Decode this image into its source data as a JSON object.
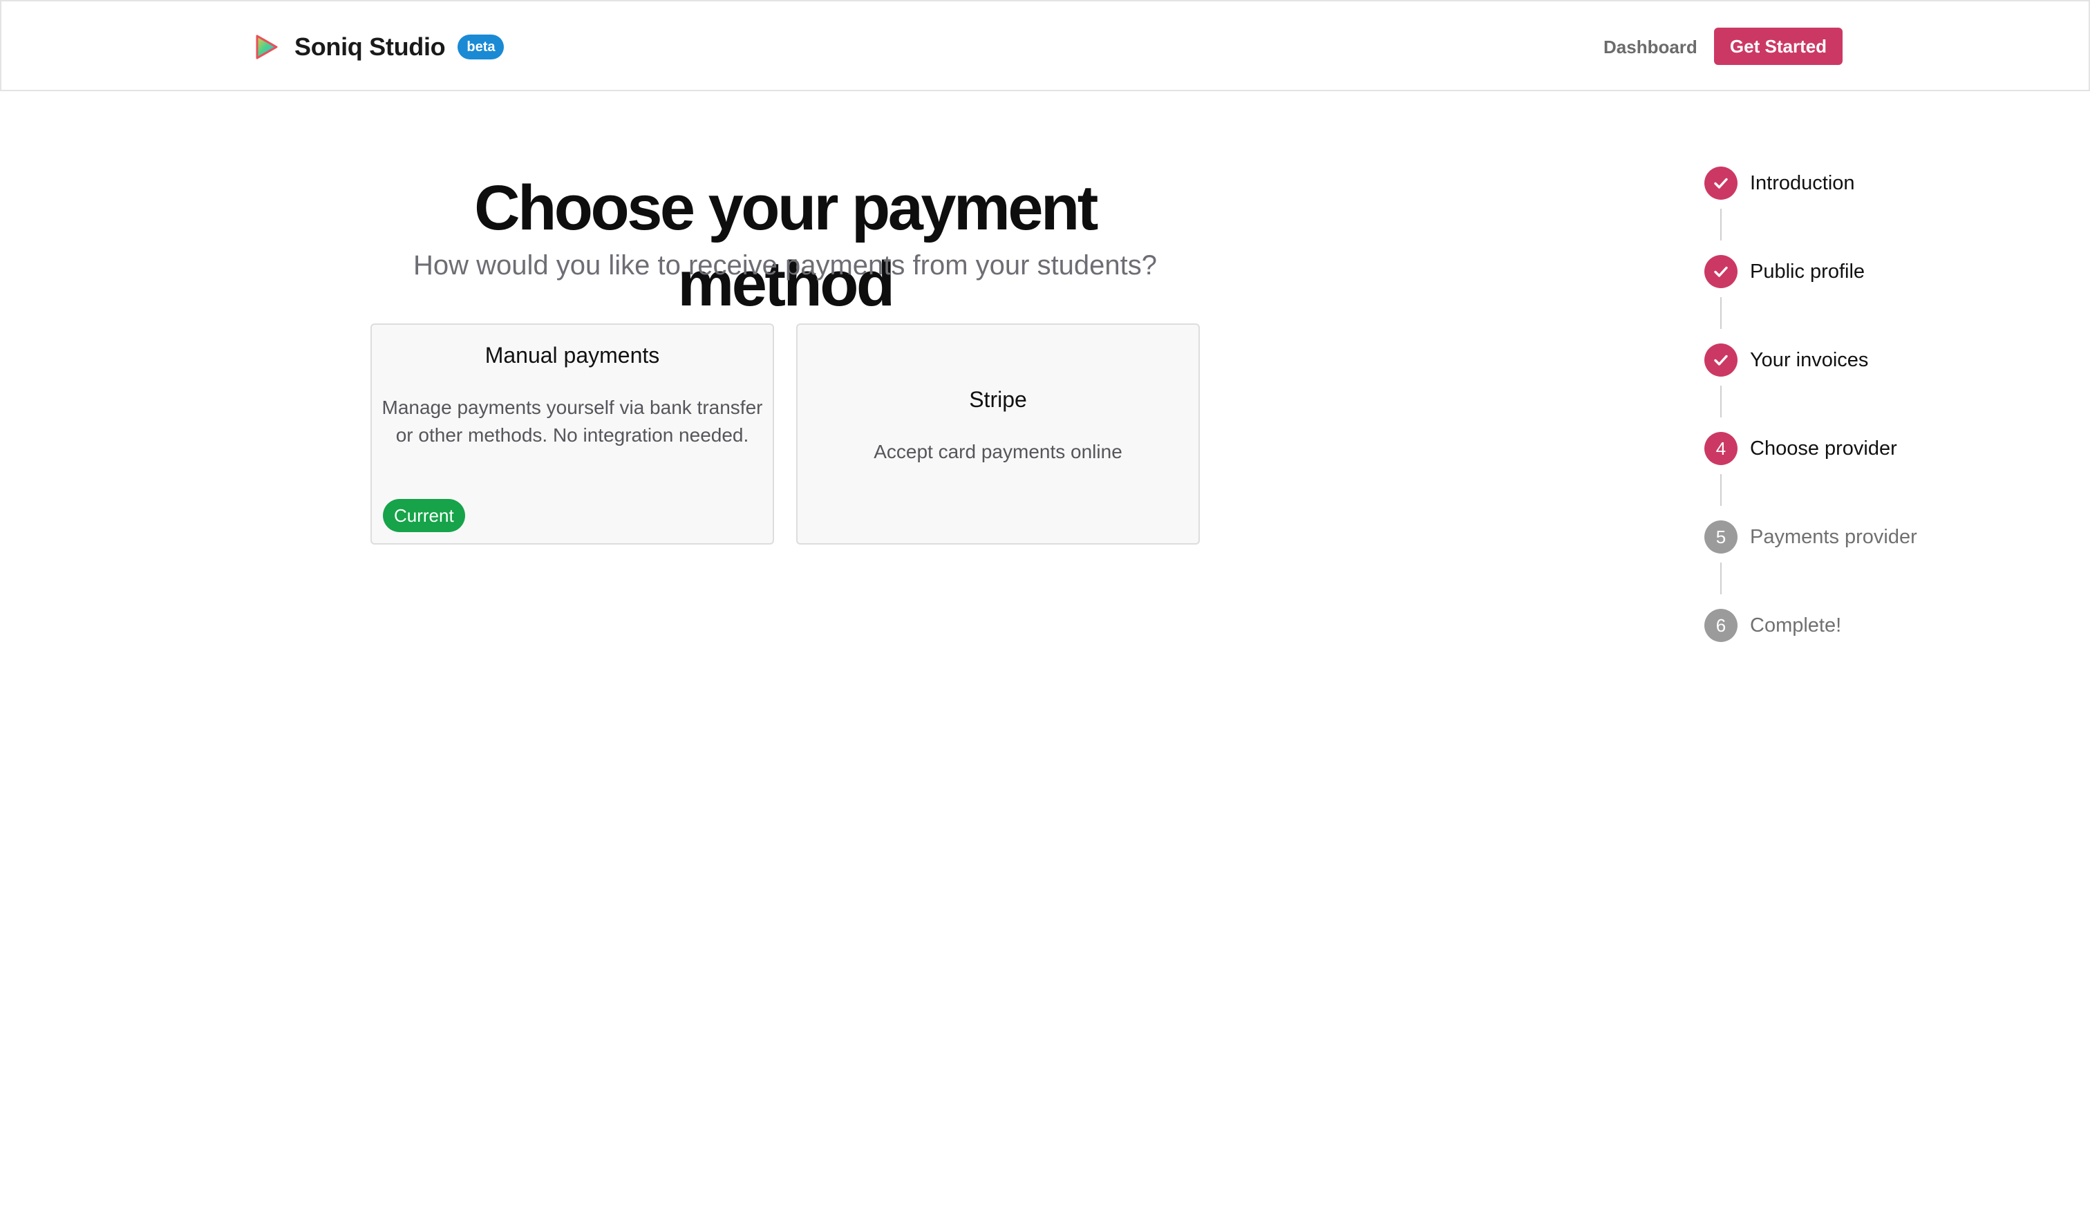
{
  "header": {
    "brand_name": "Soniq Studio",
    "beta_label": "beta",
    "nav": {
      "dashboard_label": "Dashboard",
      "get_started_label": "Get Started"
    },
    "colors": {
      "accent": "#cc3864",
      "beta": "#1a8ad4"
    }
  },
  "main": {
    "title": "Choose your payment method",
    "subtitle": "How would you like to receive payments from your students?",
    "options": [
      {
        "title": "Manual payments",
        "description": "Manage payments yourself via bank transfer or other methods. No integration needed.",
        "badge": "Current",
        "badge_color": "#16a34a"
      },
      {
        "title": "Stripe",
        "description": "Accept card payments online"
      }
    ]
  },
  "steps": [
    {
      "label": "Introduction",
      "status": "done",
      "icon": "check-icon"
    },
    {
      "label": "Public profile",
      "status": "done",
      "icon": "check-icon"
    },
    {
      "label": "Your invoices",
      "status": "done",
      "icon": "check-icon"
    },
    {
      "label": "Choose provider",
      "status": "active",
      "number": "4"
    },
    {
      "label": "Payments provider",
      "status": "todo",
      "number": "5"
    },
    {
      "label": "Complete!",
      "status": "todo",
      "number": "6"
    }
  ]
}
